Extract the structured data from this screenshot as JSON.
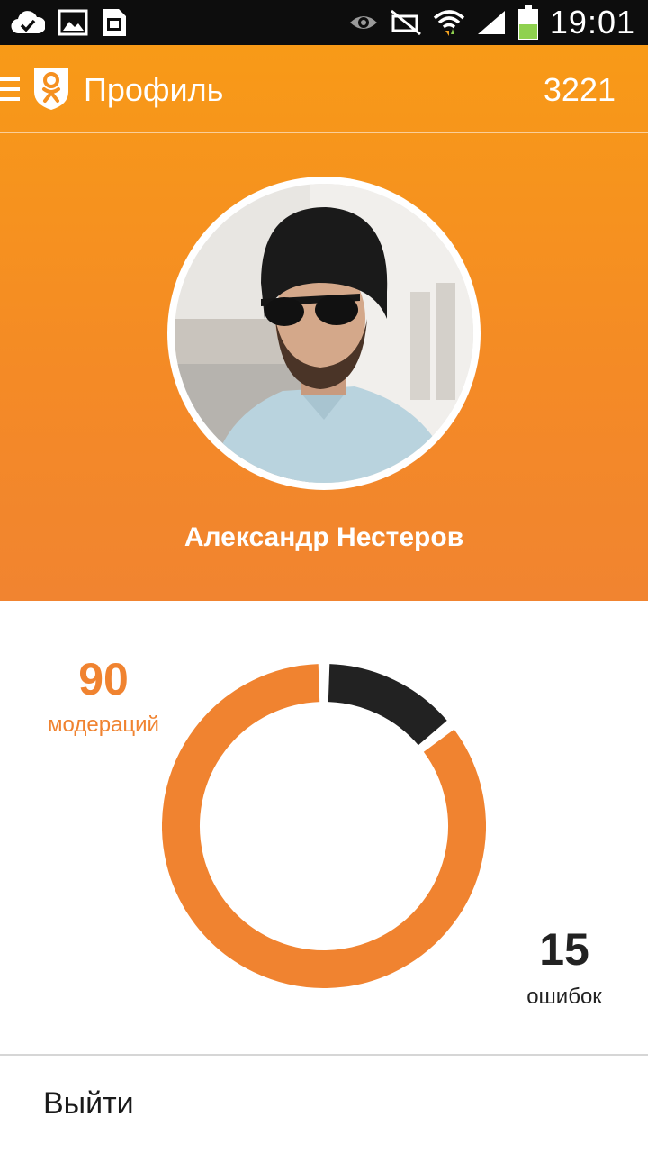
{
  "status_bar": {
    "time": "19:01",
    "left_icons": [
      "cloud-check-icon",
      "image-icon",
      "sim-card-icon"
    ],
    "right_icons": [
      "eye-icon",
      "mute-icon",
      "wifi-icon",
      "signal-icon",
      "battery-icon"
    ]
  },
  "app_bar": {
    "title": "Профиль",
    "count": "3221"
  },
  "profile": {
    "name": "Александр Нестеров"
  },
  "stats": {
    "moderations": {
      "value": "90",
      "label": "модераций"
    },
    "errors": {
      "value": "15",
      "label": "ошибок"
    }
  },
  "chart_data": {
    "type": "pie",
    "categories": [
      "модераций",
      "ошибок"
    ],
    "values": [
      90,
      15
    ],
    "colors": [
      "#f08330",
      "#222222"
    ]
  },
  "footer": {
    "logout_label": "Выйти"
  },
  "colors": {
    "accent": "#f08330",
    "header_top": "#f89a17",
    "text_dark": "#222222"
  }
}
